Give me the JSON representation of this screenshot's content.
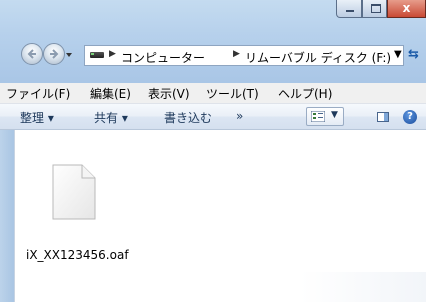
{
  "window": {
    "close_glyph": "x"
  },
  "address_bar": {
    "crumbs": [
      "コンピューター",
      "リムーバブル ディスク (F:)"
    ]
  },
  "menubar": {
    "items": [
      "ファイル(F)",
      "編集(E)",
      "表示(V)",
      "ツール(T)",
      "ヘルプ(H)"
    ]
  },
  "command_bar": {
    "organize": "整理 ▾",
    "share": "共有 ▾",
    "burn": "書き込む",
    "more": "»",
    "help_glyph": "?"
  },
  "files": [
    {
      "name": "iX_XX123456.oaf",
      "icon": "blank-document-icon"
    }
  ],
  "colors": {
    "frame": "#b7d1ec",
    "menubar": "#f0f0f0",
    "close_button": "#c94a35"
  }
}
